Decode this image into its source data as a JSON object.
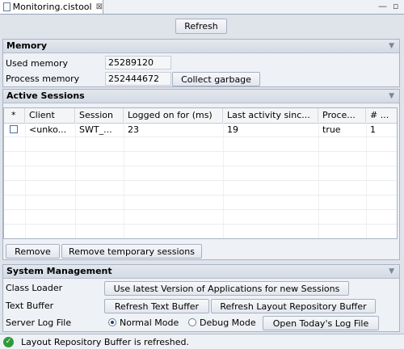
{
  "tab": {
    "title": "Monitoring.cistool",
    "close_glyph": "⊠"
  },
  "window_controls": {
    "minimize": "—",
    "maximize": "▫"
  },
  "toolbar": {
    "refresh_label": "Refresh"
  },
  "memory": {
    "title": "Memory",
    "used_label": "Used memory",
    "used_value": "25289120",
    "process_label": "Process memory",
    "process_value": "252444672",
    "collect_label": "Collect garbage"
  },
  "sessions": {
    "title": "Active Sessions",
    "columns": [
      "*",
      "Client",
      "Session",
      "Logged on for (ms)",
      "Last activity sinc...",
      "Proce...",
      "# ..."
    ],
    "rows": [
      {
        "client": "<unko...",
        "session": "SWT_...",
        "logged_on": "23",
        "last_activity": "19",
        "process": "true",
        "count": "1"
      }
    ],
    "remove_label": "Remove",
    "remove_temp_label": "Remove temporary sessions"
  },
  "system": {
    "title": "System Management",
    "class_loader_label": "Class Loader",
    "use_latest_label": "Use latest Version of Applications for new Sessions",
    "text_buffer_label": "Text Buffer",
    "refresh_text_label": "Refresh Text Buffer",
    "refresh_layout_label": "Refresh Layout Repository Buffer",
    "server_log_label": "Server Log File",
    "normal_mode_label": "Normal Mode",
    "debug_mode_label": "Debug Mode",
    "selected_mode": "Normal Mode",
    "open_log_label": "Open Today's Log File"
  },
  "status": {
    "message": "Layout Repository Buffer is refreshed.",
    "icon": "check-circle-icon"
  },
  "colors": {
    "status_ok": "#2e9b3a",
    "header_bg": "#d4dae4",
    "panel_bg": "#eef1f5"
  }
}
